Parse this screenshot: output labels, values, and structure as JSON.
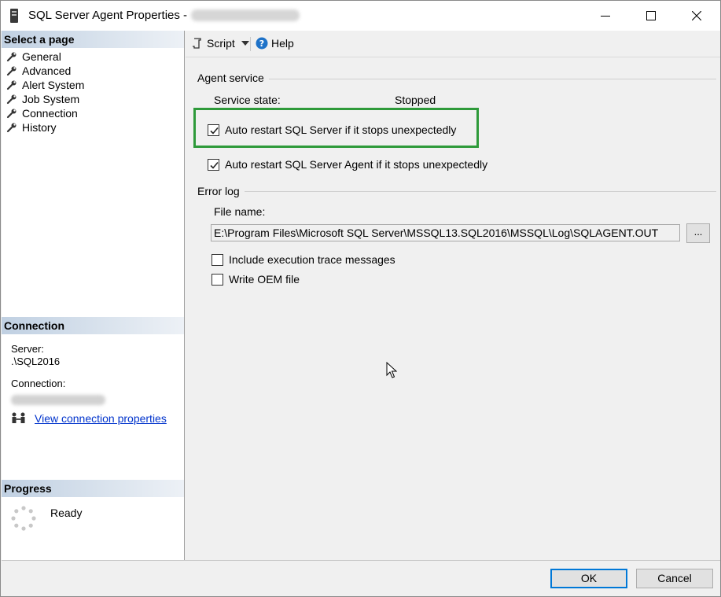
{
  "window": {
    "title": "SQL Server Agent Properties -"
  },
  "sidebar": {
    "select_header": "Select a page",
    "pages": [
      {
        "label": "General"
      },
      {
        "label": "Advanced"
      },
      {
        "label": "Alert System"
      },
      {
        "label": "Job System"
      },
      {
        "label": "Connection"
      },
      {
        "label": "History"
      }
    ],
    "connection_header": "Connection",
    "server_label": "Server:",
    "server_value": ".\\SQL2016",
    "connection_label": "Connection:",
    "view_connection_link": "View connection properties",
    "progress_header": "Progress",
    "progress_status": "Ready"
  },
  "toolbar": {
    "script_label": "Script",
    "help_label": "Help"
  },
  "agent_service": {
    "group_title": "Agent service",
    "service_state_label": "Service state:",
    "service_state_value": "Stopped",
    "auto_restart_sql_label": "Auto restart SQL Server if it stops unexpectedly",
    "auto_restart_sql_checked": true,
    "auto_restart_agent_label": "Auto restart SQL Server Agent if it stops unexpectedly",
    "auto_restart_agent_checked": true
  },
  "error_log": {
    "group_title": "Error log",
    "file_name_label": "File name:",
    "file_name_value": "E:\\Program Files\\Microsoft SQL Server\\MSSQL13.SQL2016\\MSSQL\\Log\\SQLAGENT.OUT",
    "browse_label": "...",
    "include_trace_label": "Include execution trace messages",
    "include_trace_checked": false,
    "write_oem_label": "Write OEM file",
    "write_oem_checked": false
  },
  "buttons": {
    "ok_label": "OK",
    "cancel_label": "Cancel"
  },
  "colors": {
    "highlight_border": "#2e9a3a",
    "link": "#0033cc",
    "ok_focus": "#0078d7"
  }
}
